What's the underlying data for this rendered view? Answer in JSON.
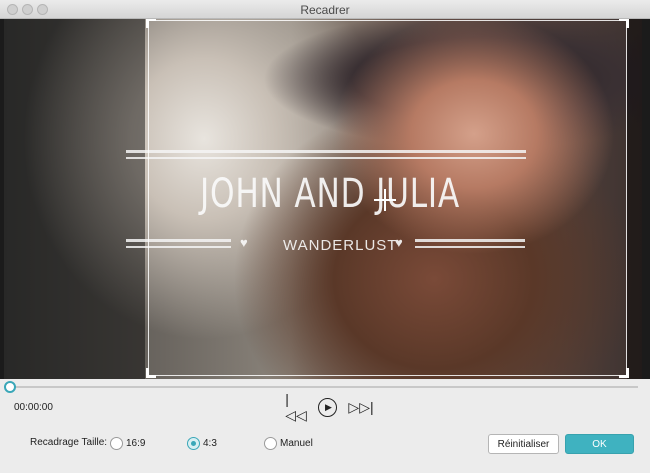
{
  "window": {
    "title": "Recadrer"
  },
  "video_overlay": {
    "heading": "JOHN AND JULIA",
    "subheading": "WANDERLUST"
  },
  "player": {
    "timecode": "00:00:00",
    "progress": 0
  },
  "crop": {
    "label": "Recadrage Taille:",
    "options": [
      {
        "label": "16:9",
        "selected": false
      },
      {
        "label": "4:3",
        "selected": true
      },
      {
        "label": "Manuel",
        "selected": false
      }
    ]
  },
  "buttons": {
    "reset_label": "Réinitialiser",
    "ok_label": "OK"
  },
  "colors": {
    "accent": "#3fb2c0"
  },
  "icons": {
    "previous": "skip-back-icon",
    "play": "play-icon",
    "next": "skip-forward-icon",
    "heart": "heart-icon"
  }
}
